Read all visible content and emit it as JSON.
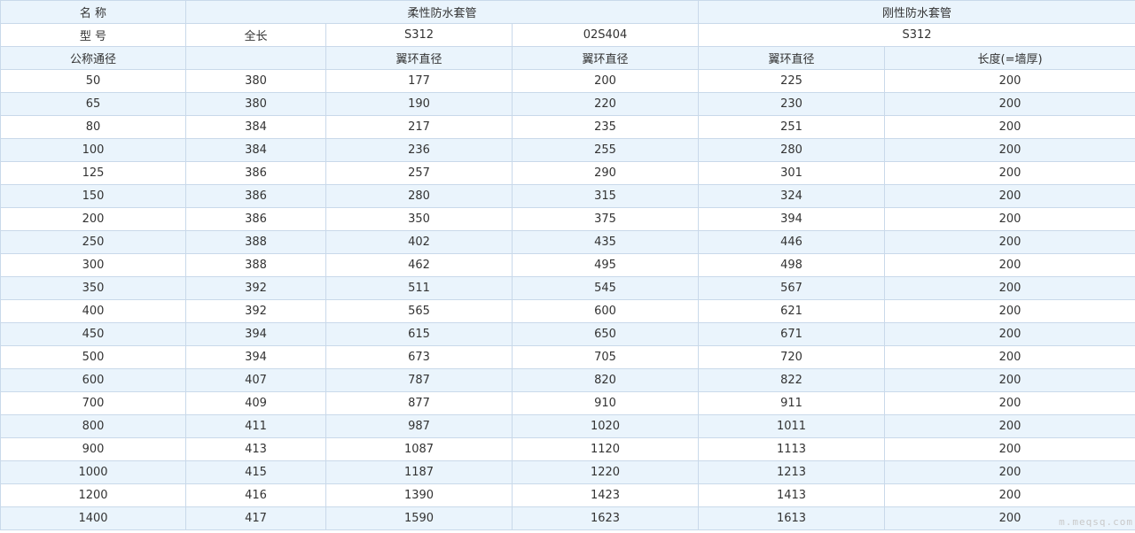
{
  "header": {
    "row1": {
      "name": "名 称",
      "flexible": "柔性防水套管",
      "rigid": "刚性防水套管"
    },
    "row2": {
      "model": "型 号",
      "total_length": "全长",
      "s312": "S312",
      "02s404": "02S404",
      "rigid_s312": "S312"
    },
    "row3": {
      "nominal_dia": "公称通径",
      "blank": "",
      "wing_dia_1": "翼环直径",
      "wing_dia_2": "翼环直径",
      "wing_dia_3": "翼环直径",
      "length": "长度(=墙厚)"
    }
  },
  "rows": [
    [
      "50",
      "380",
      "177",
      "200",
      "225",
      "200"
    ],
    [
      "65",
      "380",
      "190",
      "220",
      "230",
      "200"
    ],
    [
      "80",
      "384",
      "217",
      "235",
      "251",
      "200"
    ],
    [
      "100",
      "384",
      "236",
      "255",
      "280",
      "200"
    ],
    [
      "125",
      "386",
      "257",
      "290",
      "301",
      "200"
    ],
    [
      "150",
      "386",
      "280",
      "315",
      "324",
      "200"
    ],
    [
      "200",
      "386",
      "350",
      "375",
      "394",
      "200"
    ],
    [
      "250",
      "388",
      "402",
      "435",
      "446",
      "200"
    ],
    [
      "300",
      "388",
      "462",
      "495",
      "498",
      "200"
    ],
    [
      "350",
      "392",
      "511",
      "545",
      "567",
      "200"
    ],
    [
      "400",
      "392",
      "565",
      "600",
      "621",
      "200"
    ],
    [
      "450",
      "394",
      "615",
      "650",
      "671",
      "200"
    ],
    [
      "500",
      "394",
      "673",
      "705",
      "720",
      "200"
    ],
    [
      "600",
      "407",
      "787",
      "820",
      "822",
      "200"
    ],
    [
      "700",
      "409",
      "877",
      "910",
      "911",
      "200"
    ],
    [
      "800",
      "411",
      "987",
      "1020",
      "1011",
      "200"
    ],
    [
      "900",
      "413",
      "1087",
      "1120",
      "1113",
      "200"
    ],
    [
      "1000",
      "415",
      "1187",
      "1220",
      "1213",
      "200"
    ],
    [
      "1200",
      "416",
      "1390",
      "1423",
      "1413",
      "200"
    ],
    [
      "1400",
      "417",
      "1590",
      "1623",
      "1613",
      "200"
    ]
  ],
  "watermark": "m.meqsq.com"
}
